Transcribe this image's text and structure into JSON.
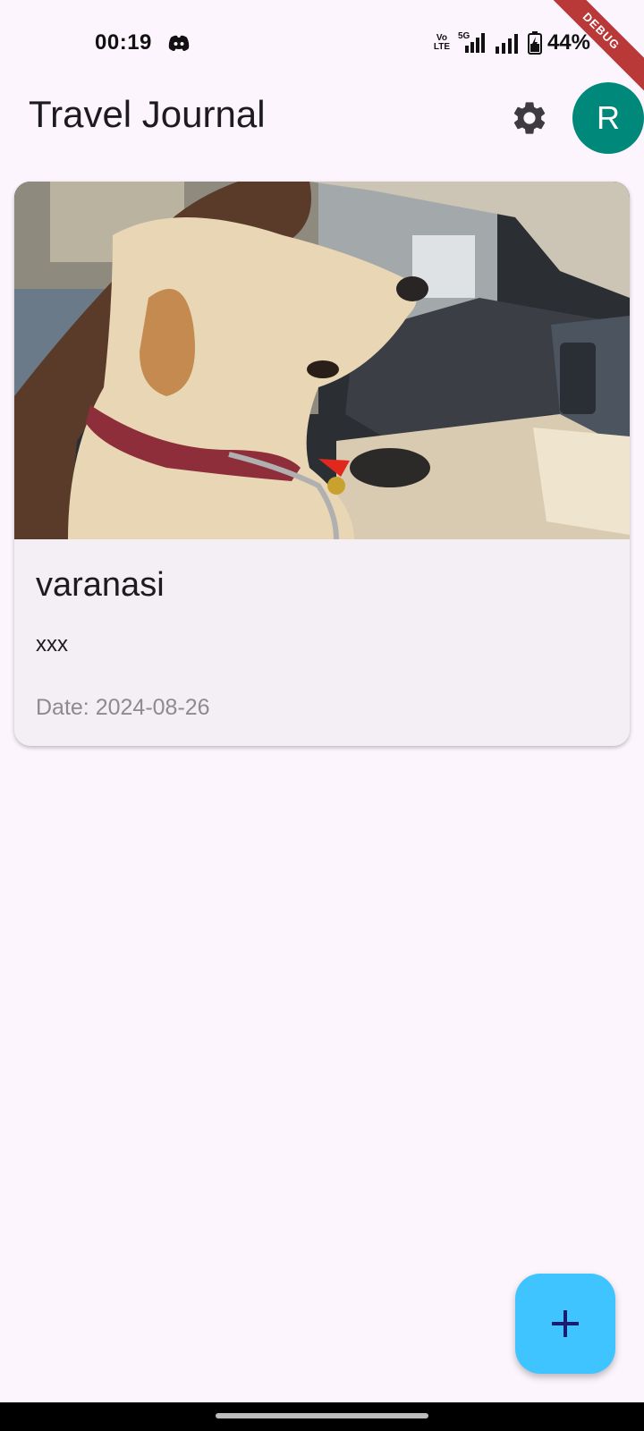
{
  "status_bar": {
    "time": "00:19",
    "notification_icon": "discord-icon",
    "volte_line1": "Vo",
    "volte_line2": "LTE",
    "network_label": "5G",
    "battery_percent": "44%"
  },
  "debug_banner": "DEBUG",
  "app_bar": {
    "title": "Travel Journal",
    "settings_icon": "gear-icon",
    "avatar_initial": "R",
    "avatar_color": "#00897b"
  },
  "entries": [
    {
      "title": "varanasi",
      "description": "xxx",
      "date": "Date: 2024-08-26",
      "photo": "dog-in-car-photo"
    }
  ],
  "fab": {
    "icon": "plus-icon",
    "color": "#40c4ff"
  },
  "colors": {
    "background": "#fcf5fd",
    "card": "#f3eff4",
    "date_text": "#8d8a90"
  }
}
